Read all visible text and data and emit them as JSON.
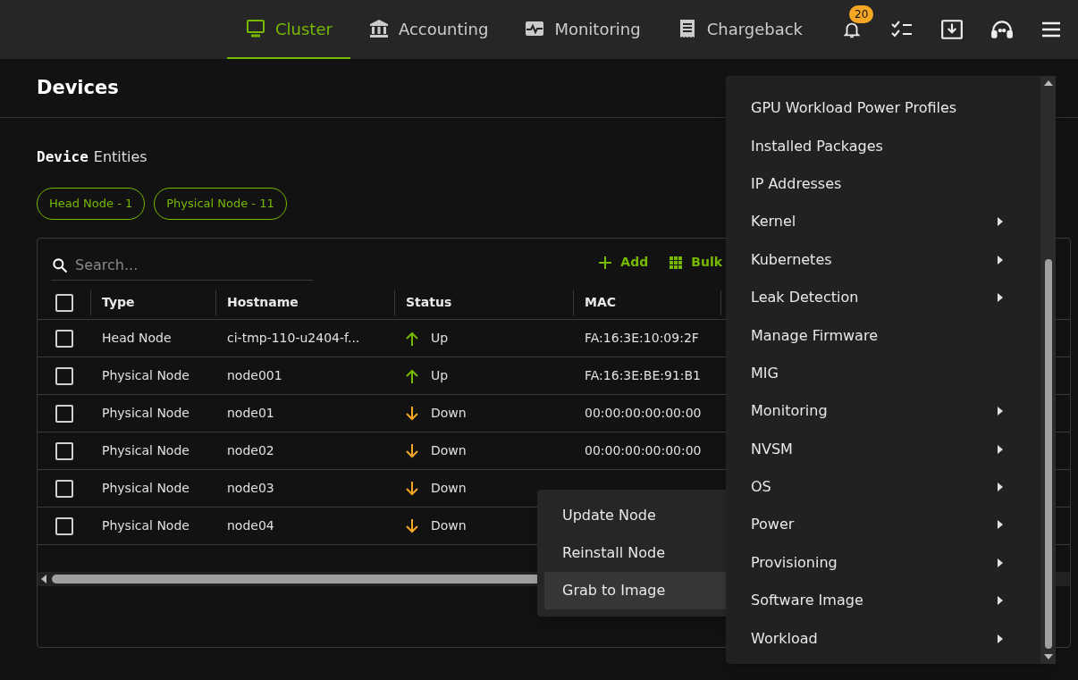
{
  "nav": {
    "tabs": [
      {
        "label": "Cluster",
        "selected": true
      },
      {
        "label": "Accounting",
        "selected": false
      },
      {
        "label": "Monitoring",
        "selected": false
      },
      {
        "label": "Chargeback",
        "selected": false
      }
    ],
    "notification_count": "20"
  },
  "page": {
    "title": "Devices",
    "section_title_bold": "Device",
    "section_title_rest": "Entities",
    "filters": [
      {
        "label": "Head Node - 1"
      },
      {
        "label": "Physical Node - 11"
      }
    ]
  },
  "table": {
    "search": {
      "placeholder": "Search..."
    },
    "actions": [
      {
        "label": "Add"
      },
      {
        "label": "Bulk"
      }
    ],
    "select_all_checked": false,
    "columns": [
      "Type",
      "Hostname",
      "Status",
      "MAC"
    ],
    "rows": [
      {
        "checked": false,
        "type": "Head Node",
        "hostname": "ci-tmp-110-u2404-f...",
        "status": "Up",
        "up": true,
        "mac": "FA:16:3E:10:09:2F"
      },
      {
        "checked": false,
        "type": "Physical Node",
        "hostname": "node001",
        "status": "Up",
        "up": true,
        "mac": "FA:16:3E:BE:91:B1"
      },
      {
        "checked": false,
        "type": "Physical Node",
        "hostname": "node01",
        "status": "Down",
        "up": false,
        "mac": "00:00:00:00:00:00"
      },
      {
        "checked": false,
        "type": "Physical Node",
        "hostname": "node02",
        "status": "Down",
        "up": false,
        "mac": "00:00:00:00:00:00"
      },
      {
        "checked": false,
        "type": "Physical Node",
        "hostname": "node03",
        "status": "Down",
        "up": false,
        "mac": ""
      },
      {
        "checked": false,
        "type": "Physical Node",
        "hostname": "node04",
        "status": "Down",
        "up": false,
        "mac": ""
      }
    ]
  },
  "context_menu": {
    "items": [
      {
        "label": "GPU Workload Power Profiles",
        "submenu": false
      },
      {
        "label": "Installed Packages",
        "submenu": false
      },
      {
        "label": "IP Addresses",
        "submenu": false
      },
      {
        "label": "Kernel",
        "submenu": true
      },
      {
        "label": "Kubernetes",
        "submenu": true
      },
      {
        "label": "Leak Detection",
        "submenu": true
      },
      {
        "label": "Manage Firmware",
        "submenu": false
      },
      {
        "label": "MIG",
        "submenu": false
      },
      {
        "label": "Monitoring",
        "submenu": true
      },
      {
        "label": "NVSM",
        "submenu": true
      },
      {
        "label": "OS",
        "submenu": true
      },
      {
        "label": "Power",
        "submenu": true
      },
      {
        "label": "Provisioning",
        "submenu": true
      },
      {
        "label": "Software Image",
        "submenu": true
      },
      {
        "label": "Workload",
        "submenu": true
      }
    ]
  },
  "submenu": {
    "items": [
      {
        "label": "Update Node",
        "selected": false
      },
      {
        "label": "Reinstall Node",
        "selected": false
      },
      {
        "label": "Grab to Image",
        "selected": true
      }
    ]
  }
}
